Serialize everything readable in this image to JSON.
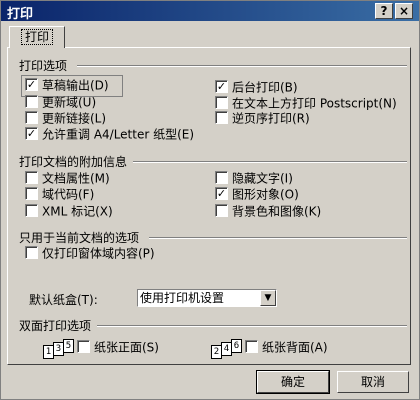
{
  "window": {
    "title": "打印",
    "help_glyph": "?",
    "close_glyph": "×"
  },
  "tabs": [
    {
      "label": "打印"
    }
  ],
  "print_options": {
    "title": "打印选项",
    "left": [
      {
        "label": "草稿输出(D)",
        "checked": true
      },
      {
        "label": "更新域(U)",
        "checked": false
      },
      {
        "label": "更新链接(L)",
        "checked": false
      },
      {
        "label": "允许重调 A4/Letter 纸型(E)",
        "checked": true
      }
    ],
    "right": [
      {
        "label": "后台打印(B)",
        "checked": true
      },
      {
        "label": "在文本上方打印 Postscript(N)",
        "checked": false
      },
      {
        "label": "逆页序打印(R)",
        "checked": false
      }
    ]
  },
  "attach_info": {
    "title": "打印文档的附加信息",
    "left": [
      {
        "label": "文档属性(M)",
        "checked": false
      },
      {
        "label": "域代码(F)",
        "checked": false
      },
      {
        "label": "XML 标记(X)",
        "checked": false
      }
    ],
    "right": [
      {
        "label": "隐藏文字(I)",
        "checked": false
      },
      {
        "label": "图形对象(O)",
        "checked": true
      },
      {
        "label": "背景色和图像(K)",
        "checked": false
      }
    ]
  },
  "current_doc": {
    "title": "只用于当前文档的选项",
    "items": [
      {
        "label": "仅打印窗体域内容(P)",
        "checked": false
      }
    ]
  },
  "tray": {
    "label": "默认纸盒(T):",
    "value": "使用打印机设置",
    "dropdown_glyph": "▼"
  },
  "duplex": {
    "title": "双面打印选项",
    "front": {
      "label": "纸张正面(S)",
      "checked": false,
      "pages": [
        "1",
        "3",
        "5"
      ]
    },
    "back": {
      "label": "纸张背面(A)",
      "checked": false,
      "pages": [
        "2",
        "4",
        "6"
      ]
    }
  },
  "buttons": {
    "ok": "确定",
    "cancel": "取消"
  },
  "check_glyph": "✓"
}
